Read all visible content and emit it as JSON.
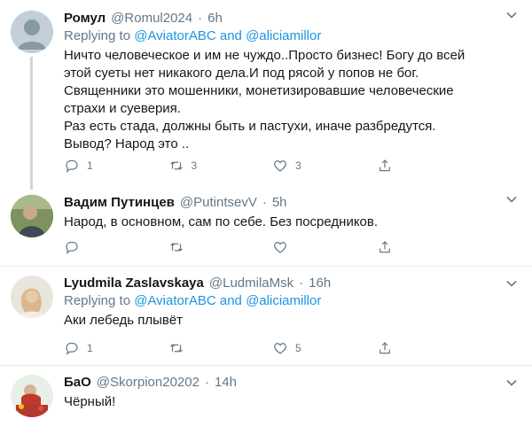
{
  "tweets": [
    {
      "name": "Ромул",
      "handle": "@Romul2024",
      "sep": "·",
      "time": "6h",
      "replying_prefix": "Replying to",
      "replying_mention1": "@AviatorABC",
      "replying_and": "and",
      "replying_mention2": "@aliciamillor",
      "text": "Ничто человеческое и им не чуждо..Просто бизнес! Богу до всей\nэтой суеты нет никакого дела.И под рясой у попов не бог.\nСвященники это мошенники, монетизировавшие человеческие\nстрахи и суеверия.\nРаз есть стада, должны быть и пастухи, иначе разбредутся.\nВывод? Народ это ..",
      "reply_count": "1",
      "retweet_count": "3",
      "like_count": "3"
    },
    {
      "name": "Вадим Путинцев",
      "handle": "@PutintsevV",
      "sep": "·",
      "time": "5h",
      "text": "Народ, в основном, сам по себе. Без посредников.",
      "reply_count": "",
      "retweet_count": "",
      "like_count": ""
    },
    {
      "name": "Lyudmila Zaslavskaya",
      "handle": "@LudmilaMsk",
      "sep": "·",
      "time": "16h",
      "replying_prefix": "Replying to",
      "replying_mention1": "@AviatorABC",
      "replying_and": "and",
      "replying_mention2": "@aliciamillor",
      "text": "Аки лебедь плывёт",
      "reply_count": "1",
      "retweet_count": "",
      "like_count": "5"
    },
    {
      "name": "БаО",
      "handle": "@Skorpion20202",
      "sep": "·",
      "time": "14h",
      "text": "Чёрный!"
    }
  ],
  "colors": {
    "text": "#14171a",
    "secondary": "#657786",
    "link": "#1b95e0",
    "divider": "#e6ecf0",
    "thread_line": "#ccd6dd"
  },
  "icons": [
    "reply-icon",
    "retweet-icon",
    "like-icon",
    "share-icon",
    "chevron-down-icon"
  ]
}
